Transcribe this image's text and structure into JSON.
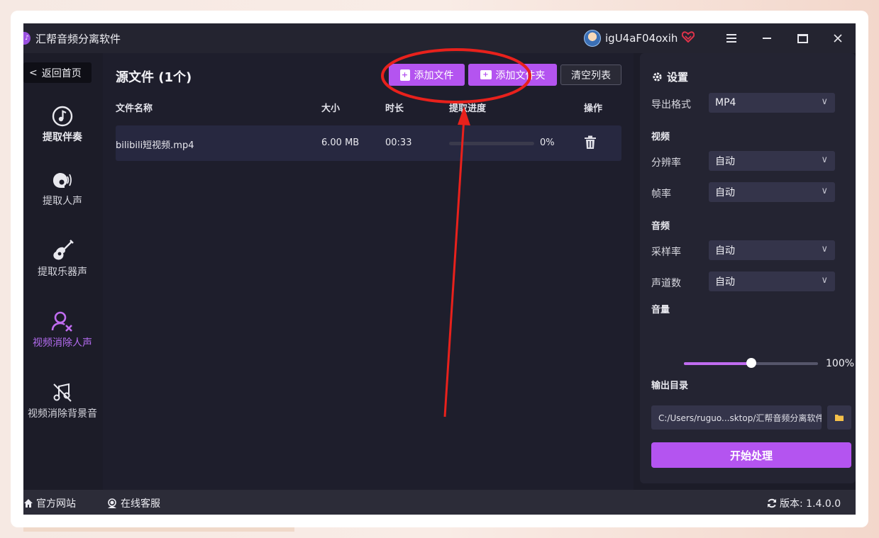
{
  "window": {
    "title": "汇帮音频分离软件",
    "username": "igU4aF04oxih"
  },
  "sidebar": {
    "back_label": "返回首页",
    "items": [
      {
        "label": "提取伴奏",
        "icon": "music-note-icon"
      },
      {
        "label": "提取人声",
        "icon": "voice-icon"
      },
      {
        "label": "提取乐器声",
        "icon": "guitar-icon"
      },
      {
        "label": "视频消除人声",
        "icon": "user-remove-icon"
      },
      {
        "label": "视频消除背景音",
        "icon": "music-off-icon"
      }
    ]
  },
  "main": {
    "title": "源文件 (1个)",
    "add_file_label": "添加文件",
    "add_folder_label": "添加文件夹",
    "clear_label": "清空列表",
    "columns": [
      "文件名称",
      "大小",
      "时长",
      "提取进度",
      "操作"
    ],
    "files": [
      {
        "name": "bilibili短视频.mp4",
        "size": "6.00 MB",
        "duration": "00:33",
        "progress": 0,
        "progress_text": "0%"
      }
    ]
  },
  "settings": {
    "title": "设置",
    "export_format_label": "导出格式",
    "export_format_value": "MP4",
    "video_section": "视频",
    "resolution_label": "分辨率",
    "resolution_value": "自动",
    "framerate_label": "帧率",
    "framerate_value": "自动",
    "audio_section": "音频",
    "samplerate_label": "采样率",
    "samplerate_value": "自动",
    "channels_label": "声道数",
    "channels_value": "自动",
    "volume_label": "音量",
    "volume_value": "100%",
    "volume_fraction": 0.5,
    "output_dir_label": "输出目录",
    "output_dir_value": "C:/Users/ruguo...sktop/汇帮音频分离软件",
    "start_label": "开始处理"
  },
  "footer": {
    "website_label": "官方网站",
    "support_label": "在线客服",
    "version_label": "版本: 1.4.0.0"
  },
  "colors": {
    "accent": "#b454f0",
    "annotation": "#e8211c",
    "background": "#1c1c28"
  }
}
